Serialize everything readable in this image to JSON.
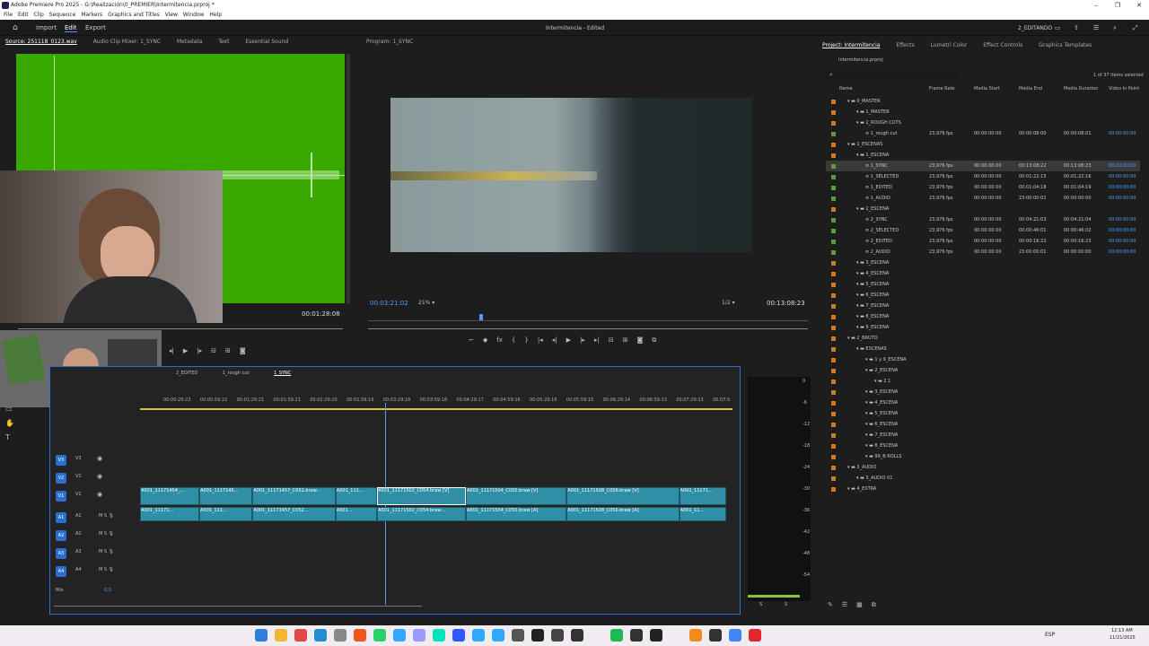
{
  "window": {
    "title": "Adobe Premiere Pro 2025 - G:\\Realización\\0_PREMIER\\Intermitencia.prproj *",
    "controls": [
      "–",
      "❐",
      "✕"
    ]
  },
  "menu": [
    "File",
    "Edit",
    "Clip",
    "Sequence",
    "Markers",
    "Graphics and Titles",
    "View",
    "Window",
    "Help"
  ],
  "workspace": {
    "tabs": [
      "Import",
      "Edit",
      "Export"
    ],
    "active": "Edit",
    "project_title": "Intermitencia - Edited",
    "workspace_name": "2_EDITANDO"
  },
  "source_panel": {
    "tabs": [
      "Source: 251118_0123.wav",
      "Audio Clip Mixer: 1_SYNC",
      "Metadata",
      "Text",
      "Essential Sound"
    ],
    "timecode": "00:01:28:08"
  },
  "program_panel": {
    "title": "Program: 1_SYNC",
    "timecode": "00:03:21:02",
    "zoom": "21%",
    "resolution": "1/2",
    "duration": "00:13:08:23"
  },
  "project_panel": {
    "tabs": [
      "Project: Intermitencia",
      "Effects",
      "Lumetri Color",
      "Effect Controls",
      "Graphics Templates"
    ],
    "file": "Intermitencia.prproj",
    "selection_count": "1 of 37 items selected",
    "columns": [
      "Name",
      "Frame Rate",
      "Media Start",
      "Media End",
      "Media Duration",
      "Video In Point"
    ],
    "rows": [
      {
        "indent": 1,
        "name": "0_MASTER",
        "fr": "",
        "ms": "",
        "me": "",
        "md": "",
        "vi": "",
        "color": "#d17a1f",
        "folder": true
      },
      {
        "indent": 2,
        "name": "1_MASTER",
        "fr": "",
        "ms": "",
        "me": "",
        "md": "",
        "vi": "",
        "color": "#d17a1f",
        "folder": true
      },
      {
        "indent": 2,
        "name": "2_ROUGH CUTS",
        "fr": "",
        "ms": "",
        "me": "",
        "md": "",
        "vi": "",
        "color": "#d17a1f",
        "folder": true
      },
      {
        "indent": 3,
        "name": "1_rough cut",
        "fr": "23,976 fps",
        "ms": "00:00:00:00",
        "me": "00:00:08:00",
        "md": "00:00:08:01",
        "vi": "00:00:00:00",
        "color": "#5a9a3a",
        "folder": false
      },
      {
        "indent": 1,
        "name": "1_ESCENAS",
        "fr": "",
        "ms": "",
        "me": "",
        "md": "",
        "vi": "",
        "color": "#d17a1f",
        "folder": true
      },
      {
        "indent": 2,
        "name": "1_ESCENA",
        "fr": "",
        "ms": "",
        "me": "",
        "md": "",
        "vi": "",
        "color": "#d17a1f",
        "folder": true
      },
      {
        "indent": 3,
        "name": "1_SYNC",
        "fr": "23,976 fps",
        "ms": "00:00:00:00",
        "me": "00:13:08:22",
        "md": "00:13:08:23",
        "vi": "00:00:00:00",
        "color": "#5a9a3a",
        "folder": false
      },
      {
        "indent": 3,
        "name": "1_SELECTED",
        "fr": "23,976 fps",
        "ms": "00:00:00:00",
        "me": "00:01:22:15",
        "md": "00:01:22:16",
        "vi": "00:00:00:00",
        "color": "#5a9a3a",
        "folder": false
      },
      {
        "indent": 3,
        "name": "1_EDITED",
        "fr": "23,976 fps",
        "ms": "00:00:00:00",
        "me": "00:01:04:18",
        "md": "00:01:04:19",
        "vi": "00:00:00:00",
        "color": "#5a9a3a",
        "folder": false
      },
      {
        "indent": 3,
        "name": "1_AUDIO",
        "fr": "23,976 fps",
        "ms": "00:00:00:00",
        "me": "23:00:00:01",
        "md": "00:00:00:00",
        "vi": "00:00:00:00",
        "color": "#5a9a3a",
        "folder": false
      },
      {
        "indent": 2,
        "name": "2_ESCENA",
        "fr": "",
        "ms": "",
        "me": "",
        "md": "",
        "vi": "",
        "color": "#d17a1f",
        "folder": true
      },
      {
        "indent": 3,
        "name": "2_SYNC",
        "fr": "23,976 fps",
        "ms": "00:00:00:00",
        "me": "00:04:21:03",
        "md": "00:04:21:04",
        "vi": "00:00:00:00",
        "color": "#5a9a3a",
        "folder": false
      },
      {
        "indent": 3,
        "name": "2_SELECTED",
        "fr": "23,976 fps",
        "ms": "00:00:00:00",
        "me": "00:00:46:01",
        "md": "00:00:46:02",
        "vi": "00:00:00:00",
        "color": "#5a9a3a",
        "folder": false
      },
      {
        "indent": 3,
        "name": "2_EDITED",
        "fr": "23,976 fps",
        "ms": "00:00:00:00",
        "me": "00:00:16:22",
        "md": "00:00:16:23",
        "vi": "00:00:00:00",
        "color": "#5a9a3a",
        "folder": false
      },
      {
        "indent": 3,
        "name": "2_AUDIO",
        "fr": "23,976 fps",
        "ms": "00:00:00:00",
        "me": "23:00:00:01",
        "md": "00:00:00:00",
        "vi": "00:00:00:00",
        "color": "#5a9a3a",
        "folder": false
      },
      {
        "indent": 2,
        "name": "3_ESCENA",
        "fr": "",
        "ms": "",
        "me": "",
        "md": "",
        "vi": "",
        "color": "#d17a1f",
        "folder": true
      },
      {
        "indent": 2,
        "name": "4_ESCENA",
        "fr": "",
        "ms": "",
        "me": "",
        "md": "",
        "vi": "",
        "color": "#d17a1f",
        "folder": true
      },
      {
        "indent": 2,
        "name": "5_ESCENA",
        "fr": "",
        "ms": "",
        "me": "",
        "md": "",
        "vi": "",
        "color": "#d17a1f",
        "folder": true
      },
      {
        "indent": 2,
        "name": "6_ESCENA",
        "fr": "",
        "ms": "",
        "me": "",
        "md": "",
        "vi": "",
        "color": "#d17a1f",
        "folder": true
      },
      {
        "indent": 2,
        "name": "7_ESCENA",
        "fr": "",
        "ms": "",
        "me": "",
        "md": "",
        "vi": "",
        "color": "#d17a1f",
        "folder": true
      },
      {
        "indent": 2,
        "name": "8_ESCENA",
        "fr": "",
        "ms": "",
        "me": "",
        "md": "",
        "vi": "",
        "color": "#d17a1f",
        "folder": true
      },
      {
        "indent": 2,
        "name": "9_ESCENA",
        "fr": "",
        "ms": "",
        "me": "",
        "md": "",
        "vi": "",
        "color": "#d17a1f",
        "folder": true
      },
      {
        "indent": 1,
        "name": "2_BRUTO",
        "fr": "",
        "ms": "",
        "me": "",
        "md": "",
        "vi": "",
        "color": "#d17a1f",
        "folder": true
      },
      {
        "indent": 2,
        "name": "ESCENAS",
        "fr": "",
        "ms": "",
        "me": "",
        "md": "",
        "vi": "",
        "color": "#d17a1f",
        "folder": true
      },
      {
        "indent": 3,
        "name": "1 y 9_ESCENA",
        "fr": "",
        "ms": "",
        "me": "",
        "md": "",
        "vi": "",
        "color": "#d17a1f",
        "folder": true
      },
      {
        "indent": 3,
        "name": "2_ESCENA",
        "fr": "",
        "ms": "",
        "me": "",
        "md": "",
        "vi": "",
        "color": "#d17a1f",
        "folder": true
      },
      {
        "indent": 4,
        "name": "2.1",
        "fr": "",
        "ms": "",
        "me": "",
        "md": "",
        "vi": "",
        "color": "#d17a1f",
        "folder": true
      },
      {
        "indent": 3,
        "name": "3_ESCENA",
        "fr": "",
        "ms": "",
        "me": "",
        "md": "",
        "vi": "",
        "color": "#d17a1f",
        "folder": true
      },
      {
        "indent": 3,
        "name": "4_ESCENA",
        "fr": "",
        "ms": "",
        "me": "",
        "md": "",
        "vi": "",
        "color": "#d17a1f",
        "folder": true
      },
      {
        "indent": 3,
        "name": "5_ESCENA",
        "fr": "",
        "ms": "",
        "me": "",
        "md": "",
        "vi": "",
        "color": "#d17a1f",
        "folder": true
      },
      {
        "indent": 3,
        "name": "6_ESCENA",
        "fr": "",
        "ms": "",
        "me": "",
        "md": "",
        "vi": "",
        "color": "#d17a1f",
        "folder": true
      },
      {
        "indent": 3,
        "name": "7_ESCENA",
        "fr": "",
        "ms": "",
        "me": "",
        "md": "",
        "vi": "",
        "color": "#d17a1f",
        "folder": true
      },
      {
        "indent": 3,
        "name": "8_ESCENA",
        "fr": "",
        "ms": "",
        "me": "",
        "md": "",
        "vi": "",
        "color": "#d17a1f",
        "folder": true
      },
      {
        "indent": 3,
        "name": "99_B ROLLS",
        "fr": "",
        "ms": "",
        "me": "",
        "md": "",
        "vi": "",
        "color": "#d17a1f",
        "folder": true
      },
      {
        "indent": 1,
        "name": "3_AUDIO",
        "fr": "",
        "ms": "",
        "me": "",
        "md": "",
        "vi": "",
        "color": "#d17a1f",
        "folder": true
      },
      {
        "indent": 2,
        "name": "3_AUDIO 01",
        "fr": "",
        "ms": "",
        "me": "",
        "md": "",
        "vi": "",
        "color": "#d17a1f",
        "folder": true
      },
      {
        "indent": 1,
        "name": "4_EXTRA",
        "fr": "",
        "ms": "",
        "me": "",
        "md": "",
        "vi": "",
        "color": "#d17a1f",
        "folder": true
      }
    ]
  },
  "timeline": {
    "tabs": [
      "2_EDITED",
      "1_rough cut",
      "1_SYNC"
    ],
    "active": "1_SYNC",
    "ruler": [
      "00:00:29:23",
      "00:00:59:22",
      "00:01:29:21",
      "00:01:59:21",
      "00:02:29:20",
      "00:02:59:19",
      "00:03:29:18",
      "00:03:59:18",
      "00:04:29:17",
      "00:04:59:16",
      "00:05:29:16",
      "00:05:59:15",
      "00:06:29:14",
      "00:06:59:13",
      "00:07:29:13",
      "00:07:5"
    ],
    "video_tracks": [
      "V3",
      "V2",
      "V1"
    ],
    "audio_tracks": [
      "A1",
      "A2",
      "A3",
      "A4"
    ],
    "mix_label": "Mix",
    "mix_value": "0,0",
    "video_clips": [
      "A001_11171454_...",
      "A001_1117145...",
      "A001_11171457_C052.braw...",
      "A001_111...",
      "A001_11171502_C054.braw [V]",
      "A001_11171504_C055.braw [V]",
      "A001_11171508_C056.braw [V]",
      "A001_11171..."
    ],
    "audio_clips": [
      "A001_11171...",
      "A001_111...",
      "A001_11171457_C052...",
      "A001...",
      "A001_11171502_C054.braw...",
      "A001_11171504_C055.braw [A]",
      "A001_11171508_C056.braw [A]",
      "A001_11..."
    ]
  },
  "meter_scale": [
    "0",
    "-6",
    "-12",
    "-18",
    "-24",
    "-30",
    "-36",
    "-42",
    "-48",
    "-54"
  ],
  "meter_bottom": [
    "S",
    "S"
  ],
  "taskbar": {
    "lang": "ESP",
    "time": "12:13 AM",
    "date": "11/21/2025"
  }
}
